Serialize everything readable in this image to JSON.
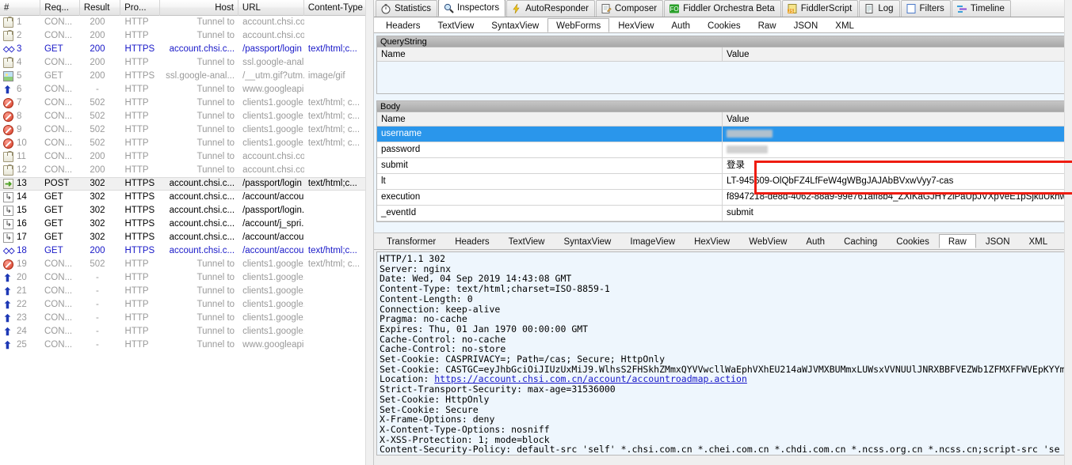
{
  "sessions": {
    "columns": [
      "#",
      "Req...",
      "Result",
      "Pro...",
      "Host",
      "URL",
      "Content-Type"
    ],
    "rows": [
      {
        "icon": "lock-icon",
        "num": "1",
        "req": "CON...",
        "result": "200",
        "proto": "HTTP",
        "host": "Tunnel to",
        "url": "account.chsi.co...",
        "ctype": "",
        "style": "gray"
      },
      {
        "icon": "lock-icon",
        "num": "2",
        "req": "CON...",
        "result": "200",
        "proto": "HTTP",
        "host": "Tunnel to",
        "url": "account.chsi.co...",
        "ctype": "",
        "style": "gray"
      },
      {
        "icon": "chevrons-icon",
        "num": "3",
        "req": "GET",
        "result": "200",
        "proto": "HTTPS",
        "host": "account.chsi.c...",
        "url": "/passport/login",
        "ctype": "text/html;c...",
        "style": "blue"
      },
      {
        "icon": "lock-icon",
        "num": "4",
        "req": "CON...",
        "result": "200",
        "proto": "HTTP",
        "host": "Tunnel to",
        "url": "ssl.google-anal...",
        "ctype": "",
        "style": "gray"
      },
      {
        "icon": "image-icon",
        "num": "5",
        "req": "GET",
        "result": "200",
        "proto": "HTTPS",
        "host": "ssl.google-anal...",
        "url": "/__utm.gif?utm...",
        "ctype": "image/gif",
        "style": "gray"
      },
      {
        "icon": "upload-icon",
        "num": "6",
        "req": "CON...",
        "result": "-",
        "proto": "HTTP",
        "host": "Tunnel to",
        "url": "www.googleapi...",
        "ctype": "",
        "style": "gray"
      },
      {
        "icon": "blocked-icon",
        "num": "7",
        "req": "CON...",
        "result": "502",
        "proto": "HTTP",
        "host": "Tunnel to",
        "url": "clients1.google...",
        "ctype": "text/html; c...",
        "style": "gray"
      },
      {
        "icon": "blocked-icon",
        "num": "8",
        "req": "CON...",
        "result": "502",
        "proto": "HTTP",
        "host": "Tunnel to",
        "url": "clients1.google...",
        "ctype": "text/html; c...",
        "style": "gray"
      },
      {
        "icon": "blocked-icon",
        "num": "9",
        "req": "CON...",
        "result": "502",
        "proto": "HTTP",
        "host": "Tunnel to",
        "url": "clients1.google...",
        "ctype": "text/html; c...",
        "style": "gray"
      },
      {
        "icon": "blocked-icon",
        "num": "10",
        "req": "CON...",
        "result": "502",
        "proto": "HTTP",
        "host": "Tunnel to",
        "url": "clients1.google...",
        "ctype": "text/html; c...",
        "style": "gray"
      },
      {
        "icon": "lock-icon",
        "num": "11",
        "req": "CON...",
        "result": "200",
        "proto": "HTTP",
        "host": "Tunnel to",
        "url": "account.chsi.co...",
        "ctype": "",
        "style": "gray"
      },
      {
        "icon": "lock-icon",
        "num": "12",
        "req": "CON...",
        "result": "200",
        "proto": "HTTP",
        "host": "Tunnel to",
        "url": "account.chsi.co...",
        "ctype": "",
        "style": "gray"
      },
      {
        "icon": "post-icon",
        "num": "13",
        "req": "POST",
        "result": "302",
        "proto": "HTTPS",
        "host": "account.chsi.c...",
        "url": "/passport/login",
        "ctype": "text/html;c...",
        "style": "black",
        "selected": true
      },
      {
        "icon": "redirect-icon",
        "num": "14",
        "req": "GET",
        "result": "302",
        "proto": "HTTPS",
        "host": "account.chsi.c...",
        "url": "/account/accou...",
        "ctype": "",
        "style": "black"
      },
      {
        "icon": "redirect-icon",
        "num": "15",
        "req": "GET",
        "result": "302",
        "proto": "HTTPS",
        "host": "account.chsi.c...",
        "url": "/passport/login...",
        "ctype": "",
        "style": "black"
      },
      {
        "icon": "redirect-icon",
        "num": "16",
        "req": "GET",
        "result": "302",
        "proto": "HTTPS",
        "host": "account.chsi.c...",
        "url": "/account/j_spri...",
        "ctype": "",
        "style": "black"
      },
      {
        "icon": "redirect-icon",
        "num": "17",
        "req": "GET",
        "result": "302",
        "proto": "HTTPS",
        "host": "account.chsi.c...",
        "url": "/account/accou...",
        "ctype": "",
        "style": "black"
      },
      {
        "icon": "chevrons-icon",
        "num": "18",
        "req": "GET",
        "result": "200",
        "proto": "HTTPS",
        "host": "account.chsi.c...",
        "url": "/account/accou...",
        "ctype": "text/html;c...",
        "style": "blue"
      },
      {
        "icon": "blocked-icon",
        "num": "19",
        "req": "CON...",
        "result": "502",
        "proto": "HTTP",
        "host": "Tunnel to",
        "url": "clients1.google...",
        "ctype": "text/html; c...",
        "style": "gray"
      },
      {
        "icon": "upload-icon",
        "num": "20",
        "req": "CON...",
        "result": "-",
        "proto": "HTTP",
        "host": "Tunnel to",
        "url": "clients1.google...",
        "ctype": "",
        "style": "gray"
      },
      {
        "icon": "upload-icon",
        "num": "21",
        "req": "CON...",
        "result": "-",
        "proto": "HTTP",
        "host": "Tunnel to",
        "url": "clients1.google...",
        "ctype": "",
        "style": "gray"
      },
      {
        "icon": "upload-icon",
        "num": "22",
        "req": "CON...",
        "result": "-",
        "proto": "HTTP",
        "host": "Tunnel to",
        "url": "clients1.google...",
        "ctype": "",
        "style": "gray"
      },
      {
        "icon": "upload-icon",
        "num": "23",
        "req": "CON...",
        "result": "-",
        "proto": "HTTP",
        "host": "Tunnel to",
        "url": "clients1.google...",
        "ctype": "",
        "style": "gray"
      },
      {
        "icon": "upload-icon",
        "num": "24",
        "req": "CON...",
        "result": "-",
        "proto": "HTTP",
        "host": "Tunnel to",
        "url": "clients1.google...",
        "ctype": "",
        "style": "gray"
      },
      {
        "icon": "upload-icon",
        "num": "25",
        "req": "CON...",
        "result": "-",
        "proto": "HTTP",
        "host": "Tunnel to",
        "url": "www.googleapi...",
        "ctype": "",
        "style": "gray"
      }
    ]
  },
  "toolbar": {
    "tabs": [
      {
        "label": "Statistics",
        "icon": "stopwatch-icon",
        "active": false
      },
      {
        "label": "Inspectors",
        "icon": "magnifier-icon",
        "active": true
      },
      {
        "label": "AutoResponder",
        "icon": "lightning-icon",
        "active": false
      },
      {
        "label": "Composer",
        "icon": "pencil-note-icon",
        "active": false
      },
      {
        "label": "Fiddler Orchestra Beta",
        "icon": "fo-badge-icon",
        "active": false
      },
      {
        "label": "FiddlerScript",
        "icon": "js-script-icon",
        "active": false
      },
      {
        "label": "Log",
        "icon": "log-icon",
        "active": false
      },
      {
        "label": "Filters",
        "icon": "filter-icon",
        "active": false
      },
      {
        "label": "Timeline",
        "icon": "timeline-icon",
        "active": false
      }
    ]
  },
  "request_tabs": {
    "tabs": [
      {
        "label": "Headers",
        "active": false
      },
      {
        "label": "TextView",
        "active": false
      },
      {
        "label": "SyntaxView",
        "active": false
      },
      {
        "label": "WebForms",
        "active": true
      },
      {
        "label": "HexView",
        "active": false
      },
      {
        "label": "Auth",
        "active": false
      },
      {
        "label": "Cookies",
        "active": false
      },
      {
        "label": "Raw",
        "active": false
      },
      {
        "label": "JSON",
        "active": false
      },
      {
        "label": "XML",
        "active": false
      }
    ]
  },
  "webforms": {
    "querystring": {
      "title": "QueryString",
      "col_name": "Name",
      "col_value": "Value",
      "rows": []
    },
    "body": {
      "title": "Body",
      "col_name": "Name",
      "col_value": "Value",
      "rows": [
        {
          "name": "username",
          "value": "",
          "redacted": true,
          "redacted_width": 58,
          "selected": true
        },
        {
          "name": "password",
          "value": "",
          "redacted": true,
          "redacted_width": 52,
          "selected": false
        },
        {
          "name": "submit",
          "value": "登录",
          "redacted": false,
          "selected": false
        },
        {
          "name": "lt",
          "value": "LT-945609-OlQbFZ4LfFeW4gWBgJAJAbBVxwVyy7-cas",
          "redacted": false,
          "selected": false,
          "highlighted": true
        },
        {
          "name": "execution",
          "value": "f8947218-de8d-4062-88a9-99e761aff8b4_ZXlKaGJHY2lPaUpJVXpVeE1pSjkuUkhwUE5uW",
          "redacted": false,
          "selected": false,
          "highlighted": true
        },
        {
          "name": "_eventId",
          "value": "submit",
          "redacted": false,
          "selected": false
        }
      ]
    },
    "highlight_color": "#ee1c11"
  },
  "response_tabs": {
    "tabs": [
      {
        "label": "Transformer",
        "active": false
      },
      {
        "label": "Headers",
        "active": false
      },
      {
        "label": "TextView",
        "active": false
      },
      {
        "label": "SyntaxView",
        "active": false
      },
      {
        "label": "ImageView",
        "active": false
      },
      {
        "label": "HexView",
        "active": false
      },
      {
        "label": "WebView",
        "active": false
      },
      {
        "label": "Auth",
        "active": false
      },
      {
        "label": "Caching",
        "active": false
      },
      {
        "label": "Cookies",
        "active": false
      },
      {
        "label": "Raw",
        "active": true
      },
      {
        "label": "JSON",
        "active": false
      },
      {
        "label": "XML",
        "active": false
      }
    ]
  },
  "raw_response": {
    "lines": [
      "HTTP/1.1 302",
      "Server: nginx",
      "Date: Wed, 04 Sep 2019 14:43:08 GMT",
      "Content-Type: text/html;charset=ISO-8859-1",
      "Content-Length: 0",
      "Connection: keep-alive",
      "Pragma: no-cache",
      "Expires: Thu, 01 Jan 1970 00:00:00 GMT",
      "Cache-Control: no-cache",
      "Cache-Control: no-store",
      "Set-Cookie: CASPRIVACY=; Path=/cas; Secure; HttpOnly",
      "Set-Cookie: CASTGC=eyJhbGciOiJIUzUxMiJ9.WlhsS2FHSkhZMmxQYVVwcllWaEphVXhEU214aWJVMXBUMmxLUWsxVVNUUlJNRXBBFVEZWb1ZFMXFFWVEpKYYmpB"
    ],
    "location_label": "Location: ",
    "location_url": "https://account.chsi.com.cn/account/accountroadmap.action",
    "lines_after": [
      "Strict-Transport-Security: max-age=31536000",
      "Set-Cookie: HttpOnly",
      "Set-Cookie: Secure",
      "X-Frame-Options: deny",
      "X-Content-Type-Options: nosniff",
      "X-XSS-Protection: 1; mode=block",
      "Content-Security-Policy: default-src 'self' *.chsi.com.cn *.chei.com.cn *.chdi.com.cn *.ncss.org.cn *.ncss.cn;script-src 'se"
    ]
  }
}
